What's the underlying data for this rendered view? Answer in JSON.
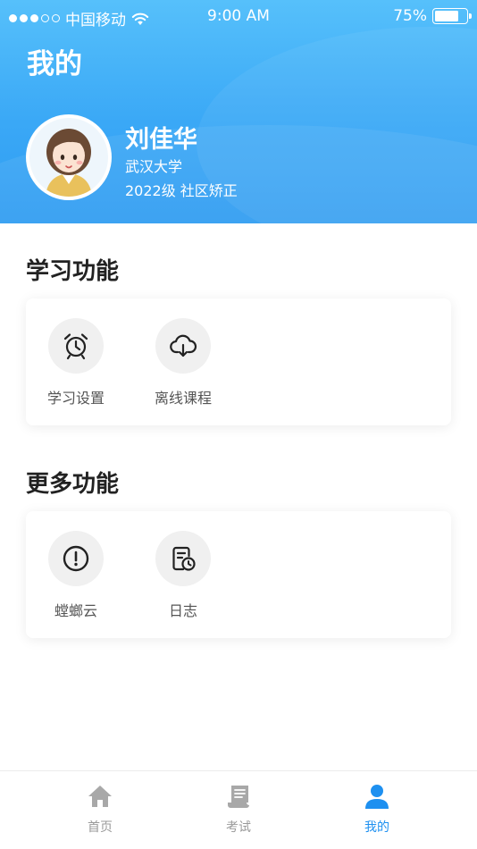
{
  "status_bar": {
    "carrier": "中国移动",
    "time": "9:00 AM",
    "battery": "75%",
    "battery_level": 0.75
  },
  "header": {
    "title": "我的"
  },
  "profile": {
    "name": "刘佳华",
    "school": "武汉大学",
    "class_info": "2022级 社区矫正"
  },
  "study_section": {
    "title": "学习功能",
    "items": [
      {
        "label": "学习设置",
        "icon": "alarm-clock-icon"
      },
      {
        "label": "离线课程",
        "icon": "cloud-download-icon"
      }
    ]
  },
  "more_section": {
    "title": "更多功能",
    "items": [
      {
        "label": "螳螂云",
        "icon": "exclamation-circle-icon"
      },
      {
        "label": "日志",
        "icon": "log-clock-icon"
      }
    ]
  },
  "tab_bar": {
    "items": [
      {
        "label": "首页",
        "icon": "home-icon"
      },
      {
        "label": "考试",
        "icon": "scroll-icon"
      },
      {
        "label": "我的",
        "icon": "user-icon"
      }
    ],
    "active_color": "#1e90f0",
    "inactive_color": "#9a9a9a"
  }
}
